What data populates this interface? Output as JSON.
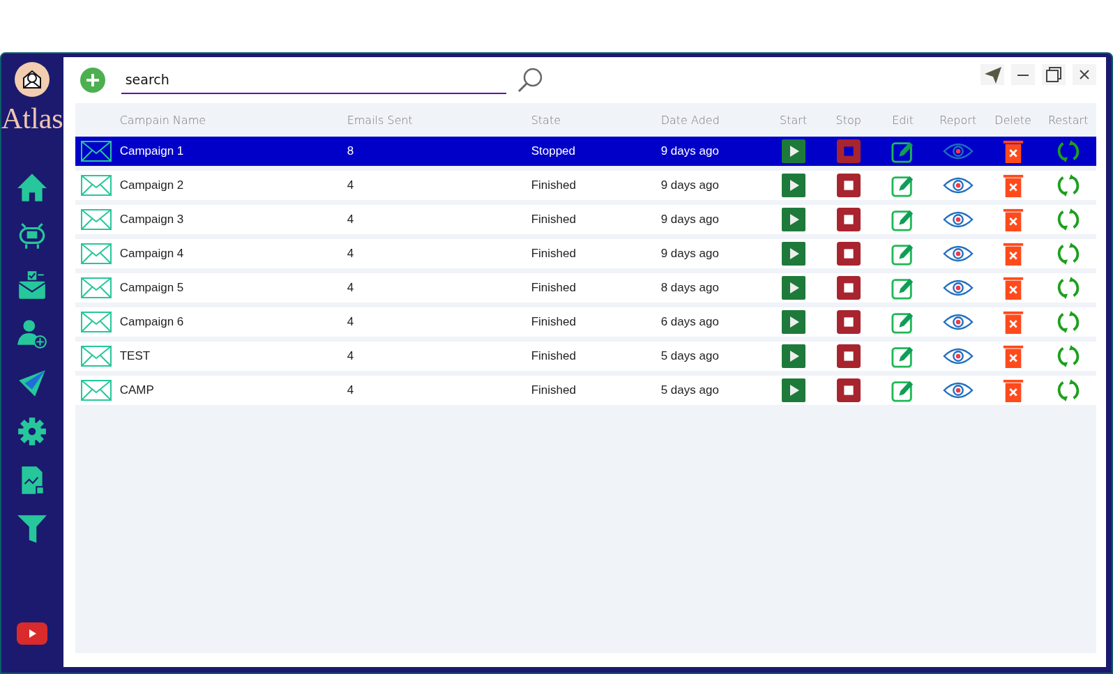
{
  "sidebar": {
    "app_name": "Atlas"
  },
  "search": {
    "placeholder": "search"
  },
  "table": {
    "columns": [
      "Campain Name",
      "Emails Sent",
      "State",
      "Date Aded",
      "Start",
      "Stop",
      "Edit",
      "Report",
      "Delete",
      "Restart"
    ],
    "rows": [
      {
        "name": "Campaign 1",
        "emails_sent": "8",
        "state": "Stopped",
        "date_added": "9 days ago",
        "selected": true
      },
      {
        "name": "Campaign 2",
        "emails_sent": "4",
        "state": "Finished",
        "date_added": "9 days ago",
        "selected": false
      },
      {
        "name": "Campaign 3",
        "emails_sent": "4",
        "state": "Finished",
        "date_added": "9 days ago",
        "selected": false
      },
      {
        "name": "Campaign 4",
        "emails_sent": "4",
        "state": "Finished",
        "date_added": "9 days ago",
        "selected": false
      },
      {
        "name": "Campaign 5",
        "emails_sent": "4",
        "state": "Finished",
        "date_added": "8 days ago",
        "selected": false
      },
      {
        "name": "Campaign 6",
        "emails_sent": "4",
        "state": "Finished",
        "date_added": "6 days ago",
        "selected": false
      },
      {
        "name": "TEST",
        "emails_sent": "4",
        "state": "Finished",
        "date_added": "5 days ago",
        "selected": false
      },
      {
        "name": "CAMP",
        "emails_sent": "4",
        "state": "Finished",
        "date_added": "5 days ago",
        "selected": false
      }
    ]
  }
}
